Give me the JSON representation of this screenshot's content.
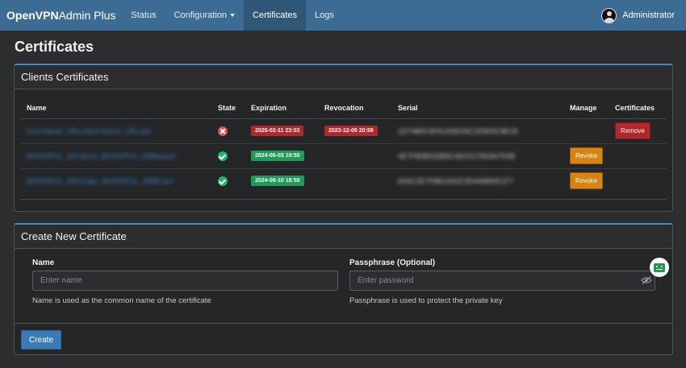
{
  "navbar": {
    "brand_bold": "OpenVPN",
    "brand_rest": "Admin Plus",
    "items": [
      {
        "label": "Status"
      },
      {
        "label": "Configuration"
      },
      {
        "label": "Certificates"
      },
      {
        "label": "Logs"
      }
    ],
    "active_item": "Certificates",
    "user": "Administrator"
  },
  "page": {
    "title": "Certificates"
  },
  "clients_panel": {
    "title": "Clients Certificates",
    "columns": [
      "Name",
      "State",
      "Expiration",
      "Revocation",
      "Serial",
      "Manage",
      "Certificates"
    ],
    "rows": [
      {
        "name": "host-Name_URLClient-Name_URLvpn",
        "state": "revoked",
        "expiration": "2025-02-11 23:03",
        "revocation": "2023-12-05 20:59",
        "serial": "1D74B0C90A1A0E93C1E9D0C8E18",
        "manage": "",
        "certificates": "Remove"
      },
      {
        "name": "BGIDSPUL_DEVprod_BGIDSPUL_DBBxpvpn",
        "state": "valid",
        "expiration": "2024-06-03 19:50",
        "revocation": "",
        "serial": "4E7F80B020B9C46C5176E9A7D9E",
        "manage": "Revoke",
        "certificates": ""
      },
      {
        "name": "BGIDSPUL_DEVLdpx_BGIDSPUL_DBBLvpn",
        "state": "valid",
        "expiration": "2024-06-10 18:50",
        "revocation": "",
        "serial": "6A9C2E7F8B15A3C9D4AB80E1F7",
        "manage": "Revoke",
        "certificates": ""
      }
    ]
  },
  "create_panel": {
    "title": "Create New Certificate",
    "name_label": "Name",
    "name_placeholder": "Enter name",
    "name_help": "Name is used as the common name of the certificate",
    "pass_label": "Passphrase (Optional)",
    "pass_placeholder": "Enter password",
    "pass_help": "Passphrase is used to protect the private key",
    "submit_label": "Create"
  },
  "colors": {
    "navbar": "#3c6c94",
    "accent": "#3a8cc4",
    "danger": "#b0282a",
    "success": "#1f9a5a",
    "warning": "#d88412"
  },
  "icons": [
    "user-avatar-icon",
    "revoked-x-icon",
    "valid-check-icon",
    "eye-slash-icon",
    "chat-bot-icon"
  ]
}
